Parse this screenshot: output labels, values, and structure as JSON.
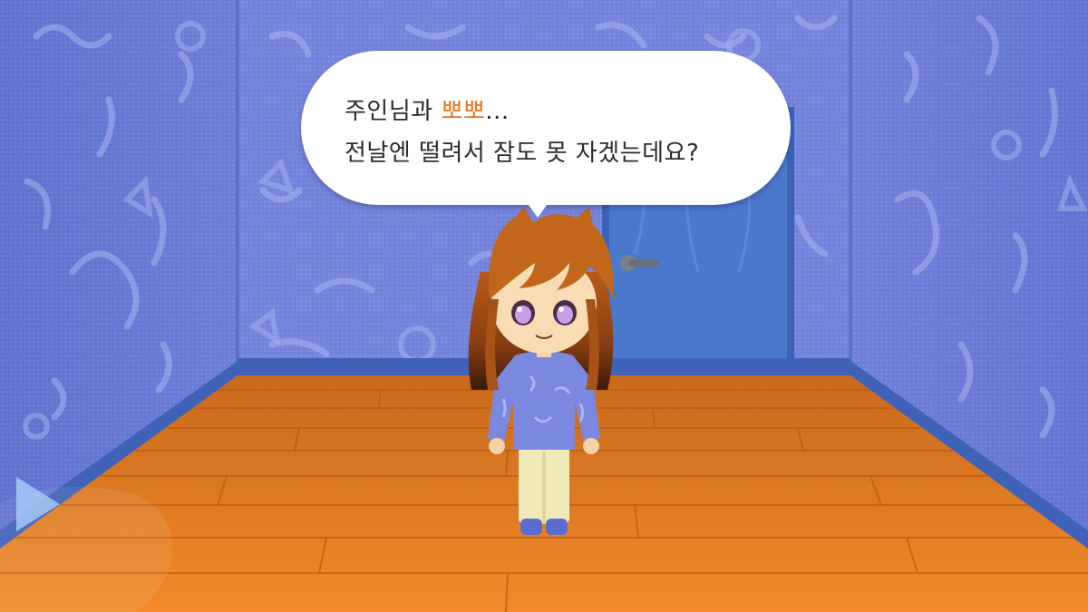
{
  "dialogue": {
    "line1_prefix": "주인님과 ",
    "line1_highlight": "뽀뽀",
    "line1_suffix": "...",
    "line2": "전날엔 떨려서 잠도 못 자겠는데요?",
    "highlight_color": "#e6761c"
  },
  "scene": {
    "wall_color": "#6f7fd9",
    "floor_color": "#e07d24",
    "door_color": "#3f6fc4"
  },
  "icons": {
    "next": "play-triangle-icon"
  }
}
